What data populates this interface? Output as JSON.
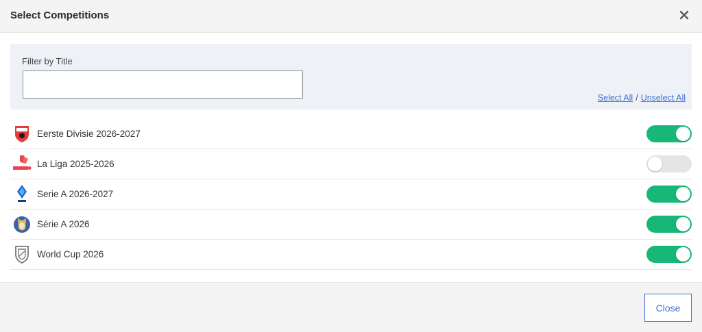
{
  "header": {
    "title": "Select Competitions"
  },
  "filter": {
    "label": "Filter by Title",
    "value": "",
    "placeholder": "",
    "select_all": "Select All",
    "separator": "/",
    "unselect_all": "Unselect All"
  },
  "competitions": [
    {
      "name": "Eerste Divisie 2026-2027",
      "icon": "eerste-divisie-logo-icon",
      "enabled": true
    },
    {
      "name": "La Liga 2025-2026",
      "icon": "la-liga-logo-icon",
      "enabled": false
    },
    {
      "name": "Serie A 2026-2027",
      "icon": "serie-a-logo-icon",
      "enabled": true
    },
    {
      "name": "Série A 2026",
      "icon": "brasileirao-logo-icon",
      "enabled": true
    },
    {
      "name": "World Cup 2026",
      "icon": "world-cup-shield-icon",
      "enabled": true
    }
  ],
  "footer": {
    "close_label": "Close"
  },
  "colors": {
    "toggle_on": "#17b877",
    "toggle_off": "#e4e5e7",
    "link": "#3f6fd1",
    "header_bg": "#f4f4f4",
    "filter_bg": "#eef2f7"
  }
}
